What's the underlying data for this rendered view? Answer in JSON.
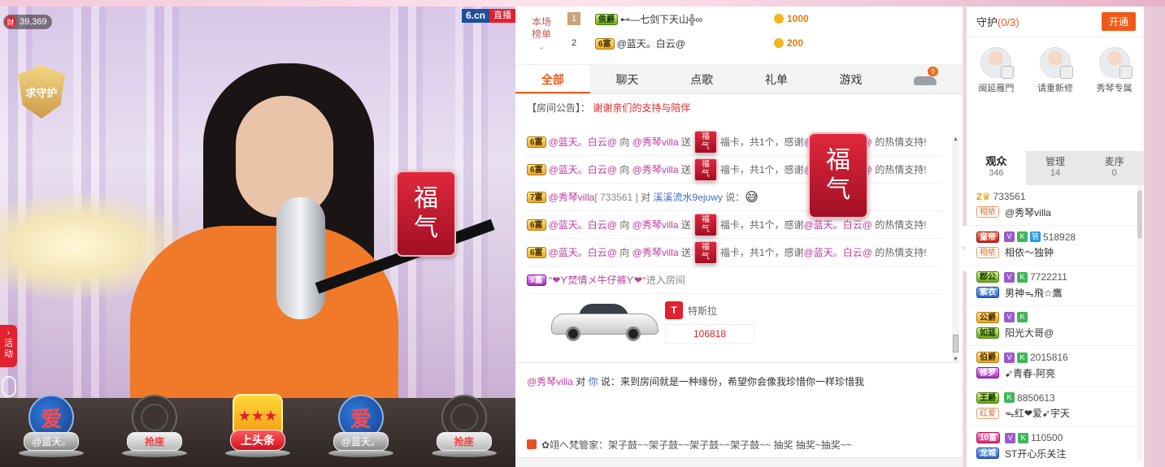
{
  "video": {
    "viewer_icon": "财",
    "viewer_count": "39,369",
    "logo_site": "6.cn",
    "logo_live": "直播",
    "guard_badge_text": "求守护",
    "fuka_text_1": "福",
    "fuka_text_2": "气",
    "activity_label": "活动"
  },
  "seats": [
    {
      "label": "@蓝天。",
      "style": "love"
    },
    {
      "label": "抢座",
      "style": "grab"
    },
    {
      "label": "上头条",
      "style": "toutiao"
    },
    {
      "label": "@蓝天。",
      "style": "love"
    },
    {
      "label": "抢座",
      "style": "grab"
    }
  ],
  "seat_love_glyph": "爱",
  "rank": {
    "label_1": "本场",
    "label_2": "榜单",
    "rows": [
      {
        "no": "1",
        "badge": "侯爵",
        "name": "⊷—七剑下天山╬∞",
        "coins": "1000"
      },
      {
        "no": "2",
        "badge": "6富",
        "name": "@蓝天。白云@",
        "coins": "200"
      }
    ]
  },
  "tabs": [
    "全部",
    "聊天",
    "点歌",
    "礼单",
    "游戏"
  ],
  "car_tab_badge": "9",
  "notice": {
    "prefix": "【房间公告】：",
    "text": "谢谢亲们的支持与陪伴"
  },
  "messages": {
    "gift": {
      "badge": "6富",
      "user": "@蓝天。白云@",
      "to": "向",
      "target": "@秀琴villa",
      "send": "送",
      "gift": "福卡，共1个，感谢",
      "thanks_user": "@蓝天。白云@",
      "thanks_tail": "的热情支持!"
    },
    "speech": {
      "badge": "7富",
      "user": "@秀琴villa",
      "id": "[ 733561 ]",
      "to": "对",
      "target": "溪溪流水9ejuwy",
      "say": "说：",
      "emoji": "😅"
    },
    "enter": {
      "badge": "9富",
      "user": "°❤ϒ焚情メ牛仔裤ϒ❤°",
      "text": "进入房间"
    },
    "car": {
      "brand_logo": "T",
      "brand": "特斯拉",
      "number": "106818"
    }
  },
  "private_msg": {
    "user": "@秀琴villa",
    "to": "对",
    "target": "你",
    "say": "说：",
    "text": "来到房间就是一种缘份，希望你会像我珍惜你一样珍惜我"
  },
  "broadcast": "✿翊へ梵管家：架子鼓~~架子鼓~~架子鼓~~架子鼓~~ 抽奖 抽奖~抽奖~~",
  "guard": {
    "title": "守护",
    "count": "(0/3)",
    "open_btn": "开通",
    "members": [
      "闽延雁門",
      "请重新修",
      "秀琴专属"
    ]
  },
  "audience_tabs": [
    {
      "label": "观众",
      "count": "346"
    },
    {
      "label": "管理",
      "count": "14"
    },
    {
      "label": "麦序",
      "count": "0"
    }
  ],
  "audience": [
    {
      "rank": "2",
      "id": "733561",
      "title": "相依",
      "name": "@秀琴villa",
      "title_style": "outline",
      "badge": "",
      "badge_style": "",
      "v": false,
      "k": false,
      "guan": false
    },
    {
      "rank": "",
      "id": "518928",
      "title": "相依",
      "name": "相依～独钟",
      "title_style": "outline",
      "badge": "皇帝",
      "badge_style": "red",
      "v": true,
      "k": true,
      "guan": true
    },
    {
      "rank": "",
      "id": "7722211",
      "title": "紫衣",
      "name": "男神ᯓ飛☆鷹",
      "title_style": "blue",
      "badge": "郡公",
      "badge_style": "green",
      "v": true,
      "k": true,
      "guan": false
    },
    {
      "rank": "",
      "id": "",
      "title": "如蓝",
      "name": "阳光大哥@",
      "title_style": "green",
      "badge": "公爵",
      "badge_style": "",
      "v": true,
      "k": true,
      "guan": false
    },
    {
      "rank": "",
      "id": "2015816",
      "title": "修罗",
      "name": "➹青春-阿亮",
      "title_style": "purple",
      "badge": "伯爵",
      "badge_style": "",
      "v": true,
      "k": true,
      "guan": false
    },
    {
      "rank": "",
      "id": "8850613",
      "title": "红爱",
      "name": "ᯓ红❤爱➹宇天",
      "title_style": "outline",
      "badge": "王爵",
      "badge_style": "green",
      "v": false,
      "k": true,
      "guan": false
    },
    {
      "rank": "",
      "id": "110500",
      "title": "龙城",
      "name": "ST开心乐关注",
      "title_style": "blue",
      "badge": "10富",
      "badge_style": "pink",
      "v": true,
      "k": true,
      "guan": false
    }
  ],
  "colors": {
    "accent": "#f05a1a",
    "gift_user": "#c03ca0",
    "link": "#3d6fcf",
    "notice": "#d82a2a"
  }
}
